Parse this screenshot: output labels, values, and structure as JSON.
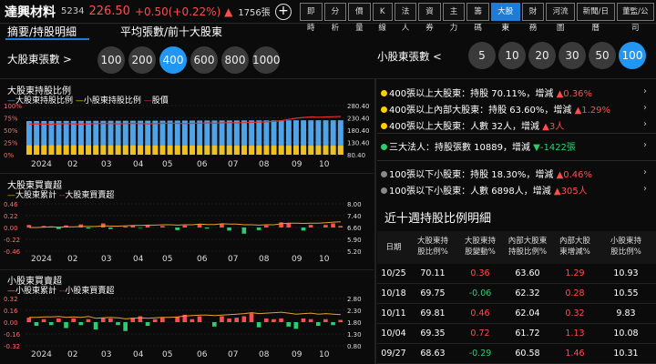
{
  "header": {
    "stock_name": "達興材料",
    "stock_code": "5234",
    "price": "226.50",
    "change": "+0.50(+0.22%)",
    "change_arrow": "▲",
    "volume": "1756張",
    "add_icon": "plus-icon"
  },
  "tabs": [
    {
      "label": "即時",
      "active": false
    },
    {
      "label": "分析",
      "active": false
    },
    {
      "label": "價量",
      "active": false
    },
    {
      "label": "K線",
      "active": false
    },
    {
      "label": "法人",
      "active": false
    },
    {
      "label": "資券",
      "active": false
    },
    {
      "label": "主力",
      "active": false
    },
    {
      "label": "籌碼",
      "active": false
    },
    {
      "label": "大股東",
      "active": true
    },
    {
      "label": "財務",
      "active": false
    },
    {
      "label": "河流圖",
      "active": false
    },
    {
      "label": "新聞/日曆",
      "active": false
    },
    {
      "label": "董監/公司",
      "active": false
    }
  ],
  "subtabs": {
    "detail": "摘要/持股明細",
    "avg": "平均張數/前十大股東"
  },
  "major_selector": {
    "label": "大股東張數 >",
    "options": [
      "100",
      "200",
      "400",
      "600",
      "800",
      "1000"
    ],
    "active": "400"
  },
  "minor_selector": {
    "label": "小股東張數 <",
    "options": [
      "5",
      "10",
      "20",
      "30",
      "50",
      "100"
    ],
    "active": "100"
  },
  "colors": {
    "blue_bar": "#4fa3e6",
    "yellow_bar": "#f0c020",
    "price_line": "#e03030",
    "cum_line": "#e8a030",
    "up": "#ff4d4d",
    "down": "#2ecc71",
    "accent": "#1e7bd8"
  },
  "chart_data": [
    {
      "type": "bar",
      "title": "大股東持股比例",
      "legend": [
        "大股東持股比例",
        "小股東持股比例",
        "股價"
      ],
      "x_labels": [
        "2024",
        "02",
        "03",
        "04",
        "05",
        "06",
        "07",
        "08",
        "09",
        "10"
      ],
      "y_left_ticks": [
        "100%",
        "75%",
        "50%",
        "25%",
        "0%"
      ],
      "y_right_ticks": [
        "280.40",
        "230.40",
        "180.40",
        "130.40",
        "80.40"
      ],
      "ylim_left": [
        0,
        100
      ],
      "ylim_right": [
        80.4,
        280.4
      ],
      "series": [
        {
          "name": "大股東持股比例",
          "values": [
            68.5,
            68.6,
            68.6,
            68.7,
            68.7,
            68.8,
            68.8,
            68.9,
            68.9,
            69.0,
            69.0,
            69.1,
            69.1,
            69.1,
            69.2,
            69.2,
            69.3,
            69.3,
            69.3,
            69.4,
            69.4,
            69.5,
            69.5,
            69.5,
            69.6,
            69.6,
            69.7,
            69.7,
            69.7,
            69.8,
            69.8,
            69.9,
            69.9,
            69.9,
            70.0,
            70.0,
            70.1,
            70.1,
            70.1,
            70.1,
            70.1,
            70.1,
            70.1
          ]
        },
        {
          "name": "小股東持股比例",
          "values": [
            19.2,
            19.2,
            19.1,
            19.1,
            19.1,
            19.0,
            19.0,
            19.0,
            18.9,
            18.9,
            18.9,
            18.8,
            18.8,
            18.8,
            18.8,
            18.7,
            18.7,
            18.7,
            18.7,
            18.6,
            18.6,
            18.6,
            18.6,
            18.5,
            18.5,
            18.5,
            18.5,
            18.5,
            18.4,
            18.4,
            18.4,
            18.4,
            18.4,
            18.4,
            18.3,
            18.3,
            18.3,
            18.3,
            18.3,
            18.3,
            18.3,
            18.3,
            18.3
          ]
        },
        {
          "name": "股價",
          "values": [
            205,
            206,
            205,
            204,
            206,
            207,
            206,
            205,
            206,
            207,
            208,
            207,
            206,
            207,
            208,
            207,
            206,
            207,
            208,
            209,
            208,
            207,
            208,
            209,
            210,
            209,
            210,
            211,
            210,
            211,
            212,
            213,
            214,
            216,
            219,
            224,
            229,
            232,
            234,
            233,
            234,
            235,
            236
          ]
        }
      ]
    },
    {
      "type": "bar",
      "title": "大股東買賣超",
      "legend": [
        "大股東累計",
        "大股東買賣超"
      ],
      "x_labels": [
        "2024",
        "02",
        "03",
        "04",
        "05",
        "06",
        "07",
        "08",
        "09",
        "10"
      ],
      "y_left_ticks": [
        "0.46",
        "0.22",
        "0.00",
        "-0.22",
        "-0.46"
      ],
      "y_right_ticks": [
        "8.00",
        "7.40",
        "6.60",
        "5.90",
        "5.20"
      ],
      "ylim_left": [
        -0.46,
        0.46
      ],
      "ylim_right": [
        5.2,
        8.0
      ],
      "series": [
        {
          "name": "大股東買賣超",
          "values": [
            0.05,
            0.0,
            0.03,
            0.02,
            -0.03,
            0.04,
            0.0,
            0.06,
            -0.02,
            0.0,
            0.08,
            -0.03,
            0.0,
            0.02,
            0.04,
            -0.01,
            0.05,
            0.0,
            0.03,
            0.0,
            -0.05,
            0.04,
            0.0,
            0.06,
            -0.02,
            0.0,
            0.07,
            -0.06,
            0.0,
            -0.12,
            0.0,
            -0.05,
            0.04,
            0.0,
            0.1,
            0.08,
            0.0,
            -0.06,
            0.05,
            0.0,
            0.05,
            0.08,
            0.03
          ]
        },
        {
          "name": "大股東累計",
          "values": [
            6.6,
            6.6,
            6.62,
            6.64,
            6.62,
            6.64,
            6.64,
            6.66,
            6.66,
            6.66,
            6.7,
            6.68,
            6.68,
            6.7,
            6.72,
            6.72,
            6.74,
            6.74,
            6.76,
            6.76,
            6.74,
            6.76,
            6.76,
            6.8,
            6.78,
            6.78,
            6.82,
            6.8,
            6.8,
            6.76,
            6.76,
            6.74,
            6.76,
            6.76,
            6.82,
            6.86,
            6.86,
            6.84,
            6.86,
            6.86,
            6.88,
            6.92,
            6.94
          ]
        }
      ]
    },
    {
      "type": "bar",
      "title": "小股東買賣超",
      "legend": [
        "小股東累計",
        "小股東買賣超"
      ],
      "x_labels": [
        "2024",
        "02",
        "03",
        "04",
        "05",
        "06",
        "07",
        "08",
        "09",
        "10"
      ],
      "y_left_ticks": [
        "0.32",
        "0.16",
        "0.00",
        "-0.16",
        "-0.32"
      ],
      "y_right_ticks": [
        "2.80",
        "2.30",
        "1.80",
        "1.30",
        "0.80"
      ],
      "ylim_left": [
        -0.32,
        0.32
      ],
      "ylim_right": [
        0.8,
        2.8
      ],
      "series": [
        {
          "name": "小股東買賣超",
          "values": [
            0.06,
            -0.05,
            0.04,
            -0.04,
            0.05,
            -0.08,
            0.05,
            -0.04,
            0.04,
            -0.1,
            0.06,
            0.05,
            -0.04,
            -0.12,
            0.06,
            0.08,
            -0.05,
            0.04,
            0.06,
            0.0,
            0.07,
            0.1,
            0.04,
            0.08,
            0.0,
            -0.06,
            0.08,
            0.05,
            0.06,
            0.08,
            0.12,
            -0.07,
            0.05,
            0.04,
            0.05,
            -0.06,
            -0.09,
            0.05,
            0.04,
            -0.05,
            0.04,
            -0.04,
            0.03
          ]
        },
        {
          "name": "小股東累計",
          "values": [
            2.0,
            2.0,
            2.02,
            2.02,
            2.04,
            2.0,
            2.02,
            2.0,
            2.04,
            1.96,
            1.98,
            2.0,
            1.98,
            1.94,
            1.96,
            1.98,
            1.96,
            1.98,
            2.0,
            2.0,
            2.02,
            2.06,
            2.08,
            2.1,
            2.1,
            2.08,
            2.1,
            2.12,
            2.14,
            2.16,
            2.2,
            2.16,
            2.18,
            2.2,
            2.22,
            2.18,
            2.14,
            2.16,
            2.18,
            2.14,
            2.16,
            2.14,
            2.12
          ]
        }
      ]
    }
  ],
  "stats": [
    {
      "dot": "yellow",
      "text": "400張以上大股東：持股 70.11%，增減 ",
      "arrow": "▲",
      "delta": "0.36%",
      "dir": "up"
    },
    {
      "dot": "yellow",
      "text": "400張以上內部大股東：持股 63.60%，增減 ",
      "arrow": "▲",
      "delta": "1.29%",
      "dir": "up"
    },
    {
      "dot": "yellow",
      "text": "400張以上大股東：人數 32人，增減 ",
      "arrow": "▲",
      "delta": "3人",
      "dir": "up"
    },
    {
      "dot": "green",
      "text": "三大法人：持股張數 10889，增減 ",
      "arrow": "▼",
      "delta": "-1422張",
      "dir": "down"
    },
    {
      "dot": "gray",
      "text": "100張以下小股東：持股 18.30%，增減 ",
      "arrow": "▲",
      "delta": "0.46%",
      "dir": "up"
    },
    {
      "dot": "gray",
      "text": "100張以下小股東：人數 6898人，增減 ",
      "arrow": "▲",
      "delta": "305人",
      "dir": "up"
    }
  ],
  "table": {
    "title": "近十週持股比例明細",
    "headers": [
      "日期",
      "大股東持股比例%",
      "大股東持股變動%",
      "內部大股東持股比例%",
      "內部大股東增減%",
      "小股東持股比例%"
    ],
    "rows": [
      {
        "date": "10/25",
        "c1": "70.11",
        "c2": "0.36",
        "c2dir": "up",
        "c3": "63.60",
        "c4": "1.29",
        "c4dir": "up",
        "c5": "10.93"
      },
      {
        "date": "10/18",
        "c1": "69.75",
        "c2": "-0.06",
        "c2dir": "down",
        "c3": "62.32",
        "c4": "0.28",
        "c4dir": "up",
        "c5": "10.55"
      },
      {
        "date": "10/11",
        "c1": "69.81",
        "c2": "0.46",
        "c2dir": "up",
        "c3": "62.04",
        "c4": "0.32",
        "c4dir": "up",
        "c5": "9.83"
      },
      {
        "date": "10/04",
        "c1": "69.35",
        "c2": "0.72",
        "c2dir": "up",
        "c3": "61.72",
        "c4": "1.13",
        "c4dir": "up",
        "c5": "10.08"
      },
      {
        "date": "09/27",
        "c1": "68.63",
        "c2": "-0.29",
        "c2dir": "down",
        "c3": "60.58",
        "c4": "1.46",
        "c4dir": "up",
        "c5": "10.31"
      }
    ]
  }
}
